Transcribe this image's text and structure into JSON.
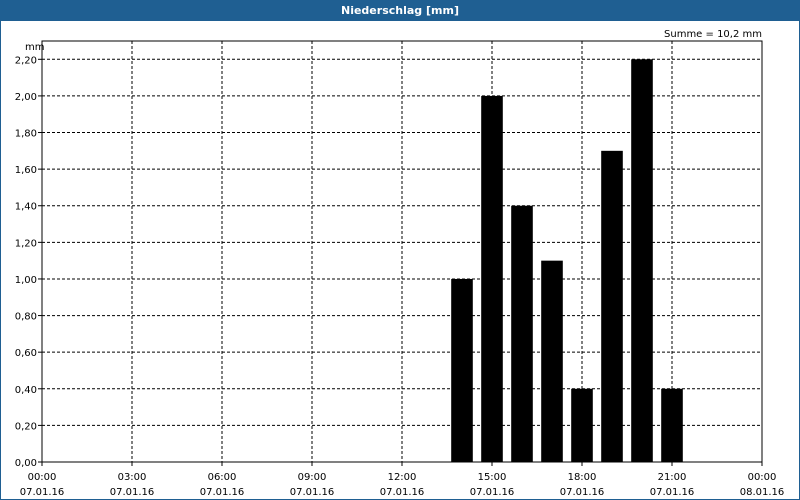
{
  "window": {
    "title": "Niederschlag [mm]"
  },
  "chart_data": {
    "type": "bar",
    "title": "Niederschlag [mm]",
    "ylabel": "mm",
    "annotation": "Summe = 10,2 mm",
    "ylim": [
      0,
      2.3
    ],
    "yticks": [
      "0,00",
      "0,20",
      "0,40",
      "0,60",
      "0,80",
      "1,00",
      "1,20",
      "1,40",
      "1,60",
      "1,80",
      "2,00",
      "2,20"
    ],
    "x_range_hours": [
      0,
      24
    ],
    "xticks": [
      {
        "time": "00:00",
        "date": "07.01.16"
      },
      {
        "time": "03:00",
        "date": "07.01.16"
      },
      {
        "time": "06:00",
        "date": "07.01.16"
      },
      {
        "time": "09:00",
        "date": "07.01.16"
      },
      {
        "time": "12:00",
        "date": "07.01.16"
      },
      {
        "time": "15:00",
        "date": "07.01.16"
      },
      {
        "time": "18:00",
        "date": "07.01.16"
      },
      {
        "time": "21:00",
        "date": "07.01.16"
      },
      {
        "time": "00:00",
        "date": "08.01.16"
      }
    ],
    "bars": [
      {
        "hour": 14,
        "value": 1.0
      },
      {
        "hour": 15,
        "value": 2.0
      },
      {
        "hour": 16,
        "value": 1.4
      },
      {
        "hour": 17,
        "value": 1.1
      },
      {
        "hour": 18,
        "value": 0.4
      },
      {
        "hour": 19,
        "value": 1.7
      },
      {
        "hour": 20,
        "value": 2.2
      },
      {
        "hour": 21,
        "value": 0.4
      }
    ],
    "grid": true,
    "bar_color": "#000000"
  }
}
